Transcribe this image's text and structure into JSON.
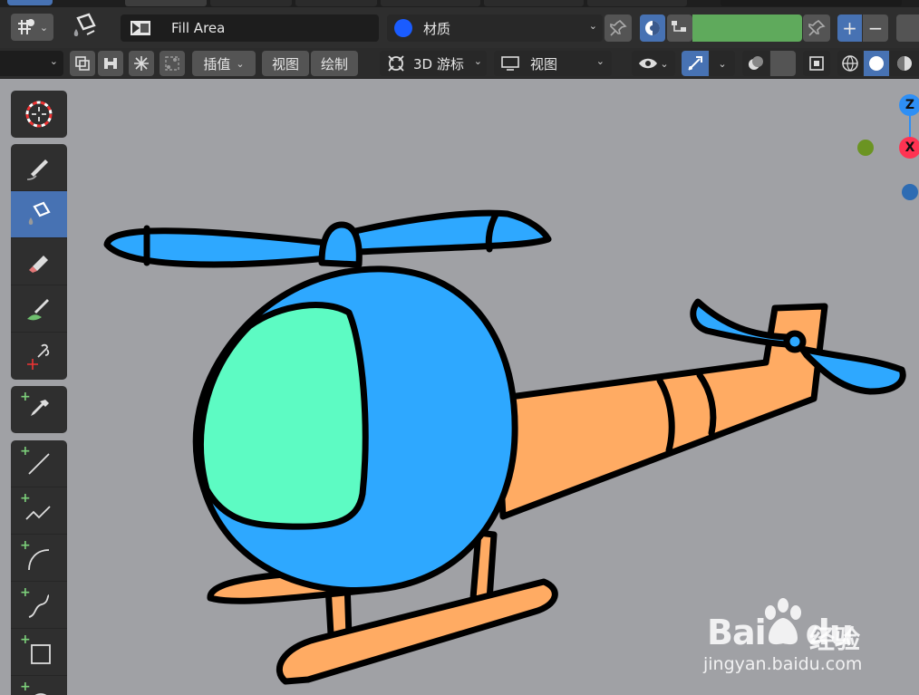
{
  "header": {
    "brush_name": "Fill Area",
    "material_label": "材质",
    "interpolate_label": "插值",
    "view_label": "视图",
    "draw_label": "绘制",
    "cursor_label": "3D 游标",
    "viewport_view_label": "视图",
    "plus_label": "+",
    "minus_label": "−",
    "material_color": "#1a5cff",
    "fill_color": "#5faa5c"
  },
  "gizmo": {
    "z_label": "Z",
    "x_label": "X",
    "z_color": "#2e8ff5",
    "x_color": "#ff3352",
    "y_color": "#6b9422",
    "neg_z_color": "#2e6cb3"
  },
  "toolbar": {
    "tools": [
      "cursor-icon",
      "draw-icon",
      "fill-icon",
      "erase-icon",
      "tint-icon",
      "cutter-icon",
      "eyedropper-icon",
      "line-icon",
      "polyline-icon",
      "arc-icon",
      "curve-icon",
      "box-icon",
      "circle-icon"
    ],
    "active_tool": "fill-icon"
  },
  "canvas": {
    "body_color": "#2ea8ff",
    "window_color": "#5dfbc3",
    "tail_color": "#ffab63",
    "outline_color": "#000000"
  },
  "watermark": {
    "brand_bai": "Bai",
    "brand_du": "du",
    "brand_cn": "经验",
    "url": "jingyan.baidu.com"
  }
}
